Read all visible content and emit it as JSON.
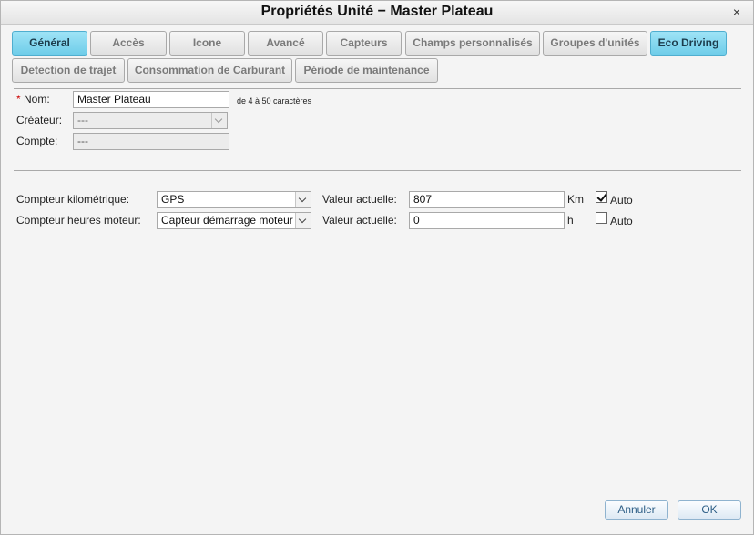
{
  "window": {
    "title": "Propriétés Unité − Master Plateau",
    "close_symbol": "×"
  },
  "tabs_row1": [
    {
      "label": "Général",
      "active": true
    },
    {
      "label": "Accès"
    },
    {
      "label": "Icone"
    },
    {
      "label": "Avancé"
    },
    {
      "label": "Capteurs"
    },
    {
      "label": "Champs personnalisés"
    },
    {
      "label": "Groupes d'unités"
    },
    {
      "label": "Eco Driving",
      "active": true
    }
  ],
  "tabs_row2": [
    {
      "label": "Detection de trajet"
    },
    {
      "label": "Consommation de Carburant"
    },
    {
      "label": "Période de maintenance"
    }
  ],
  "general": {
    "name_required_mark": "*",
    "name_label": "Nom:",
    "name_value": "Master Plateau",
    "name_hint": "de 4 à 50 caractères",
    "creator_label": "Créateur:",
    "creator_value": "---",
    "account_label": "Compte:",
    "account_value": "---"
  },
  "counters": {
    "mileage_label": "Compteur kilométrique:",
    "mileage_select": "GPS",
    "mileage_current_label": "Valeur actuelle:",
    "mileage_current_value": "807",
    "mileage_unit": "Km",
    "mileage_auto_label": "Auto",
    "mileage_auto_checked": true,
    "engine_label": "Compteur heures moteur:",
    "engine_select": "Capteur démarrage moteur",
    "engine_current_label": "Valeur actuelle:",
    "engine_current_value": "0",
    "engine_unit": "h",
    "engine_auto_label": "Auto",
    "engine_auto_checked": false
  },
  "footer": {
    "cancel_label": "Annuler",
    "ok_label": "OK"
  },
  "colors": {
    "active_tab": "#6fcde9",
    "button_text": "#2d5e86",
    "required_mark": "#cc0000"
  }
}
